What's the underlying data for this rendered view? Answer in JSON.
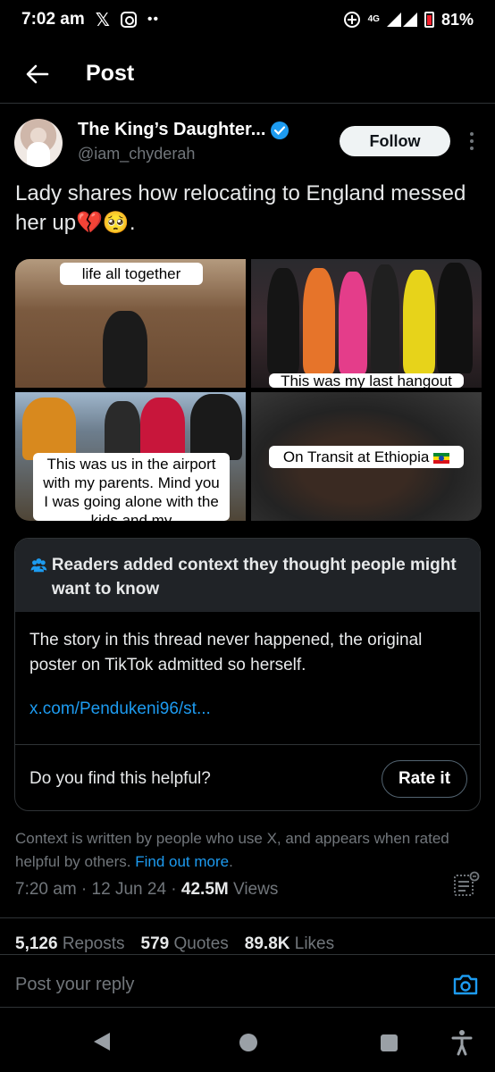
{
  "status_bar": {
    "time": "7:02 am",
    "network": "4G",
    "battery": "81%"
  },
  "header": {
    "title": "Post"
  },
  "author": {
    "name": "The King’s Daughter...",
    "handle": "@iam_chyderah",
    "follow_label": "Follow"
  },
  "post": {
    "text": "Lady shares how relocating to England messed her up💔🥺."
  },
  "media": {
    "captions": [
      "life all together",
      "This was my last hangout",
      "This was us in the airport with my parents. Mind you I was going alone with the kids and my",
      "On Transit at Ethiopia"
    ]
  },
  "note": {
    "heading": "Readers added context they thought people might want to know",
    "text": "The story in this thread never happened, the original poster on TikTok admitted so herself.",
    "link": "x.com/Pendukeni96/st...",
    "question": "Do you find this helpful?",
    "rate_label": "Rate it"
  },
  "context": {
    "text": "Context is written by people who use X, and appears when rated helpful by others.",
    "link": "Find out more",
    "suffix": "."
  },
  "meta": {
    "time": "7:20 am",
    "date": "12 Jun 24",
    "views_count": "42.5M",
    "views_label": "Views"
  },
  "stats": {
    "reposts_count": "5,126",
    "reposts_label": "Reposts",
    "quotes_count": "579",
    "quotes_label": "Quotes",
    "likes_count": "89.8K",
    "likes_label": "Likes"
  },
  "reply": {
    "placeholder": "Post your reply"
  },
  "colors": {
    "background": "#000000",
    "accent": "#1d9bf0",
    "secondary_text": "#71767b",
    "note_header_bg": "#202327"
  }
}
